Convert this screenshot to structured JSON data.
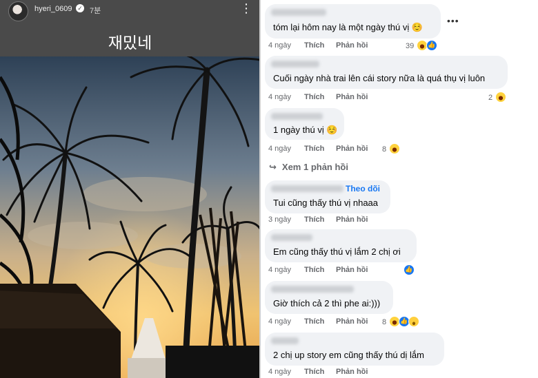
{
  "story": {
    "username": "hyeri_0609",
    "time": "7분",
    "caption": "재밌네"
  },
  "comments": [
    {
      "text": "tóm lại hôm nay là một ngày thú vị ☺️",
      "time": "4 ngày",
      "like": "Thích",
      "reply": "Phản hồi",
      "reaction_count": "39"
    },
    {
      "text": "Cuối ngày nhà trai lên cái story nữa là quá thụ vị luôn",
      "time": "4 ngày",
      "like": "Thích",
      "reply": "Phản hồi",
      "reaction_count": "2"
    },
    {
      "text": "1 ngày thú vị ☺️",
      "time": "4 ngày",
      "like": "Thích",
      "reply": "Phản hồi",
      "reaction_count": "8"
    },
    {
      "text": "Tui cũng thấy thú vị nhaaa",
      "time": "3 ngày",
      "like": "Thích",
      "reply": "Phản hồi",
      "follow": "Theo dõi"
    },
    {
      "text": "Em cũng thấy thú vị lắm 2 chị ơi",
      "time": "4 ngày",
      "like": "Thích",
      "reply": "Phản hồi"
    },
    {
      "text": "Giờ thích cả 2 thì phe ai:)))",
      "time": "4 ngày",
      "like": "Thích",
      "reply": "Phản hồi",
      "reaction_count": "8"
    },
    {
      "text": "2 chị up story em cũng thấy thú dị lắm",
      "time": "4 ngày",
      "like": "Thích",
      "reply": "Phản hồi"
    }
  ],
  "view_replies": "Xem 1 phản hồi",
  "icons": {
    "more": "more-vertical-icon",
    "comment_more": "more-horizontal-icon",
    "verified": "verified-badge-icon",
    "reply_arrow": "reply-arrow-icon",
    "haha": "haha-reaction-icon",
    "like": "like-reaction-icon",
    "care": "care-reaction-icon",
    "sad": "sad-reaction-icon"
  },
  "colors": {
    "link": "#1877f2",
    "bubble": "#f0f2f5",
    "meta": "#65676b"
  }
}
